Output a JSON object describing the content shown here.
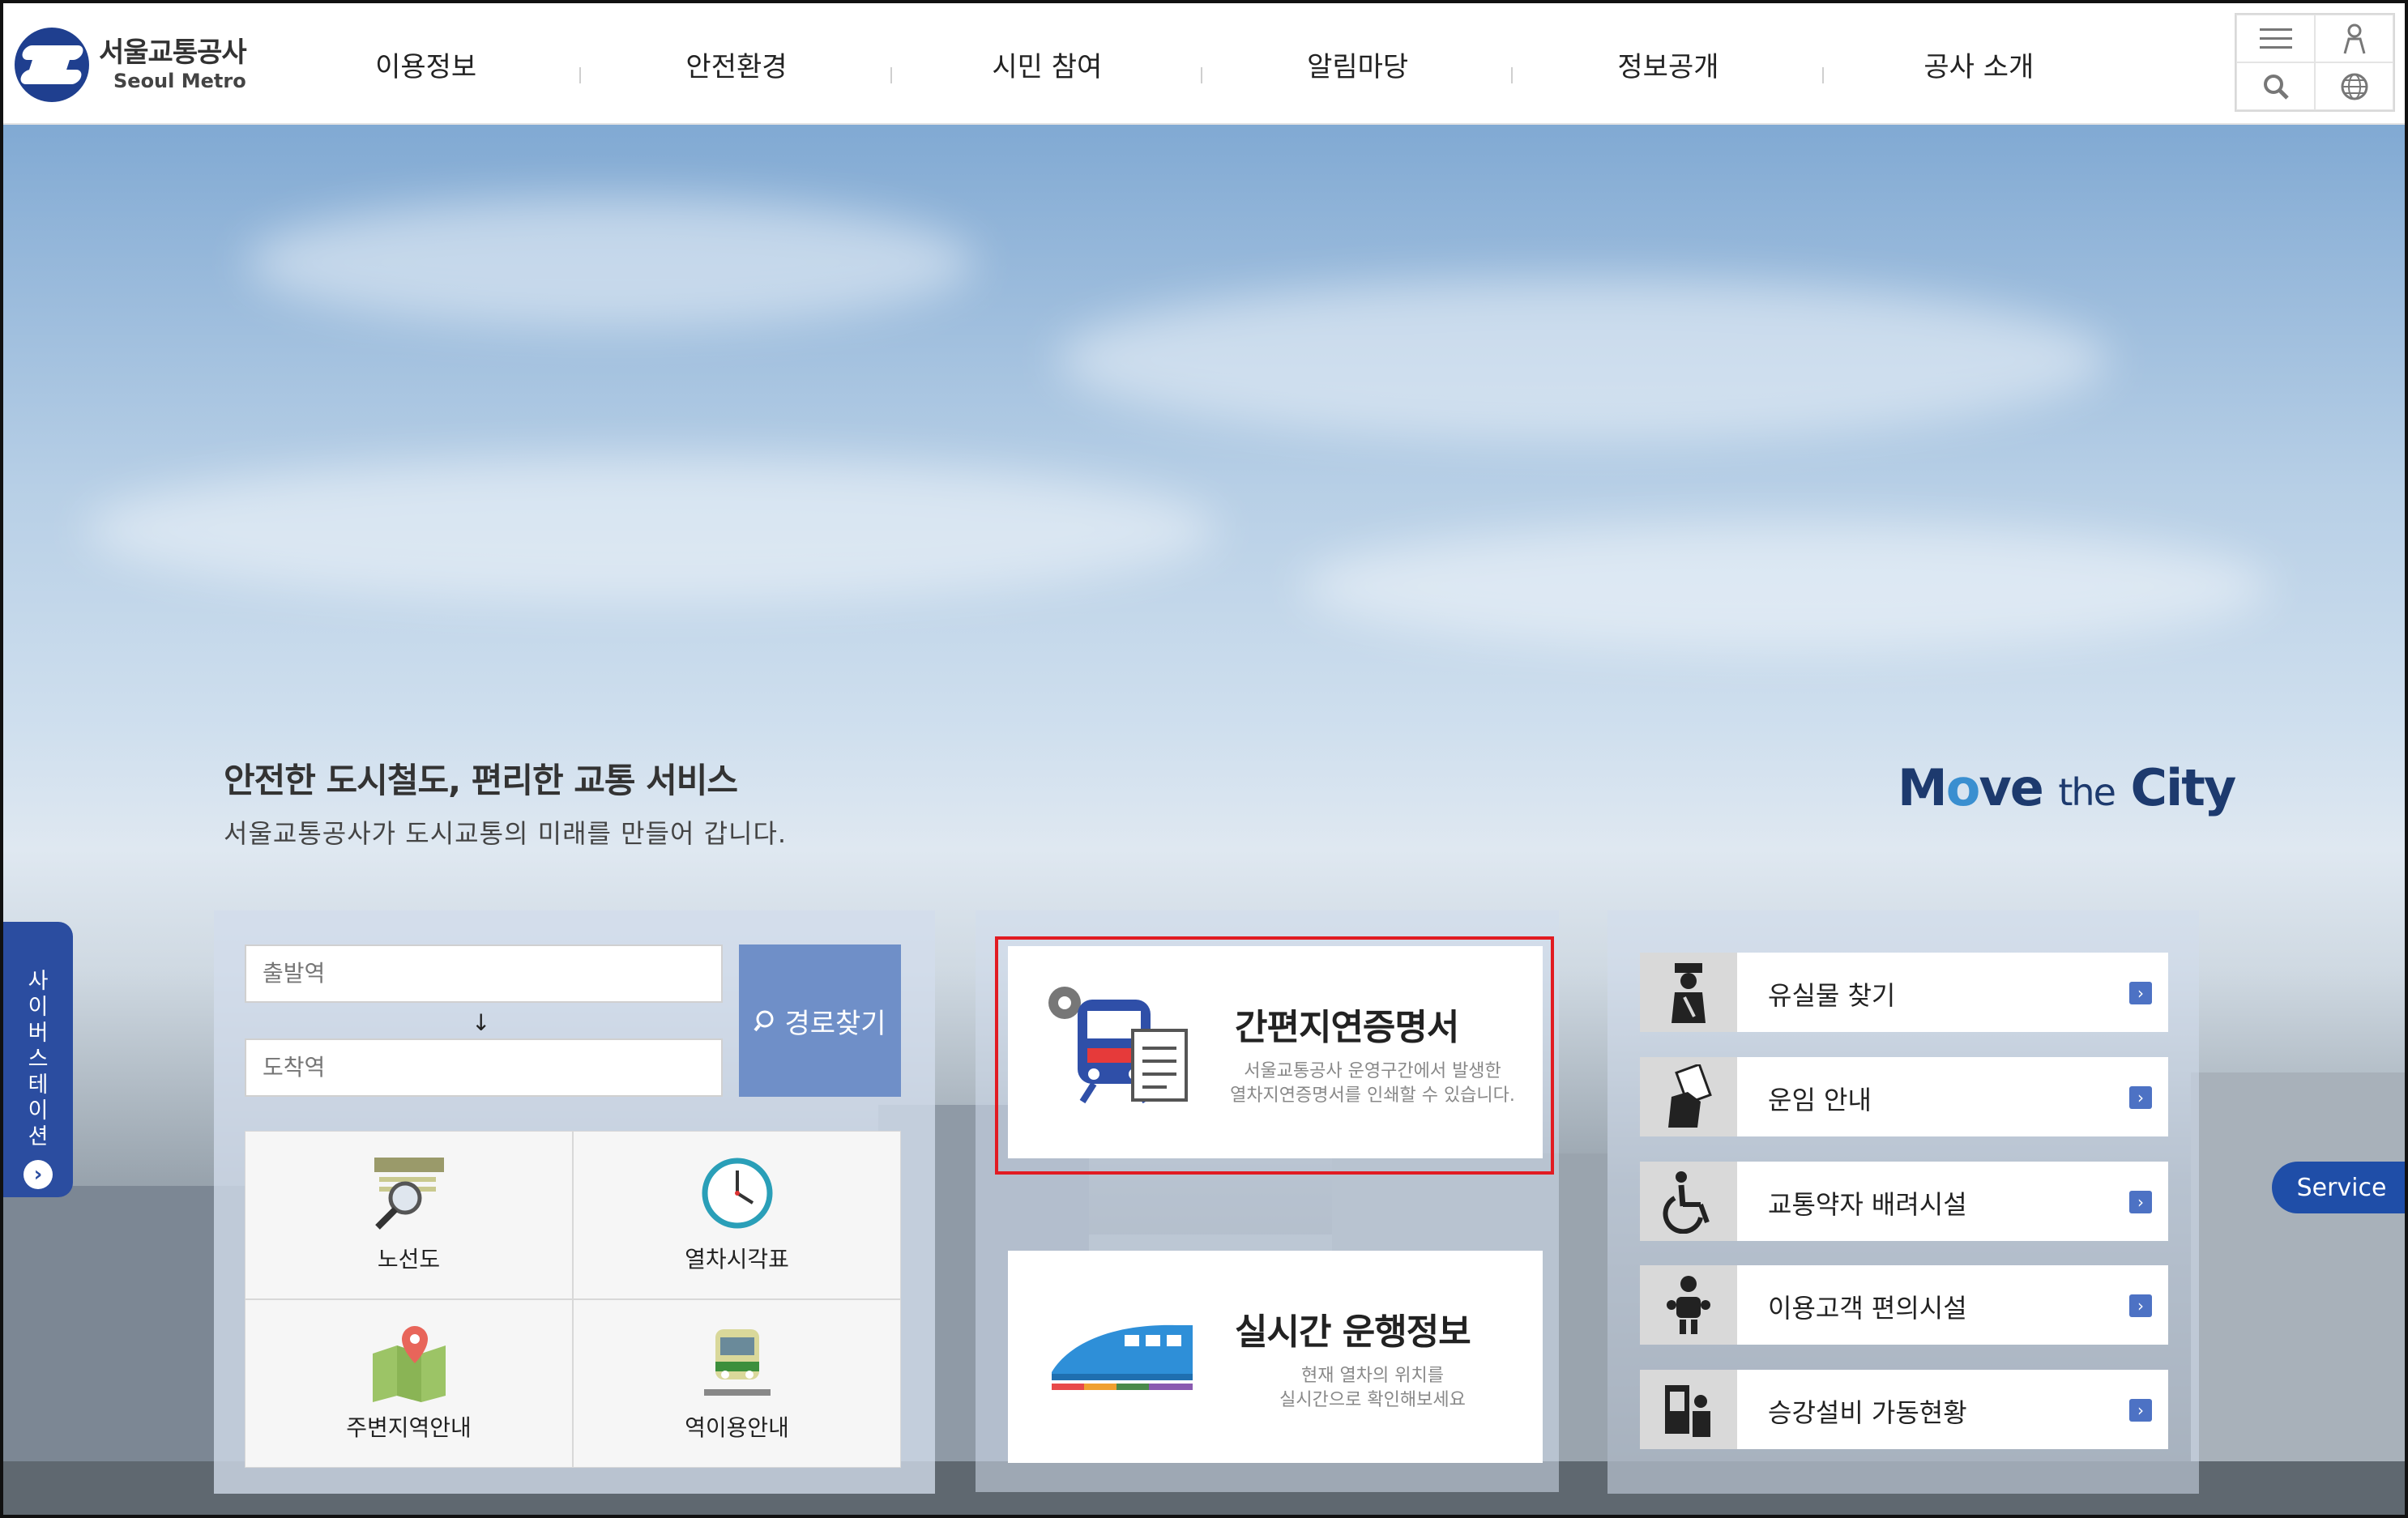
{
  "header": {
    "logo_ko": "서울교통공사",
    "logo_en": "Seoul Metro",
    "nav": [
      "이용정보",
      "안전환경",
      "시민 참여",
      "알림마당",
      "정보공개",
      "공사 소개"
    ]
  },
  "hero": {
    "title": "안전한 도시철도, 편리한 교통 서비스",
    "subtitle": "서울교통공사가 도시교통의 미래를 만들어 갑니다.",
    "slogan_parts": [
      "M",
      "o",
      "ve ",
      "the",
      " City"
    ]
  },
  "cyber_station": {
    "chars": [
      "사",
      "이",
      "버",
      "스",
      "테",
      "이",
      "션"
    ],
    "arrow": "›"
  },
  "service_tab": "Service",
  "route": {
    "departure_placeholder": "출발역",
    "arrival_placeholder": "도착역",
    "arrow": "↓",
    "button_label": "경로찾기",
    "quick_links": [
      "노선도",
      "열차시각표",
      "주변지역안내",
      "역이용안내"
    ]
  },
  "cards": [
    {
      "title": "간편지연증명서",
      "desc_line1": "서울교통공사 운영구간에서 발생한",
      "desc_line2": "열차지연증명서를 인쇄할 수 있습니다."
    },
    {
      "title": "실시간 운행정보",
      "desc_line1": "현재 열차의 위치를",
      "desc_line2": "실시간으로 확인해보세요"
    }
  ],
  "services": [
    "유실물 찾기",
    "운임 안내",
    "교통약자 배려시설",
    "이용고객 편의시설",
    "승강설비 가동현황"
  ],
  "colors": {
    "brand_navy": "#1f3f8f",
    "accent_blue": "#2b4da0",
    "highlight_red": "#e11b22",
    "route_button": "#6f8fc8"
  }
}
